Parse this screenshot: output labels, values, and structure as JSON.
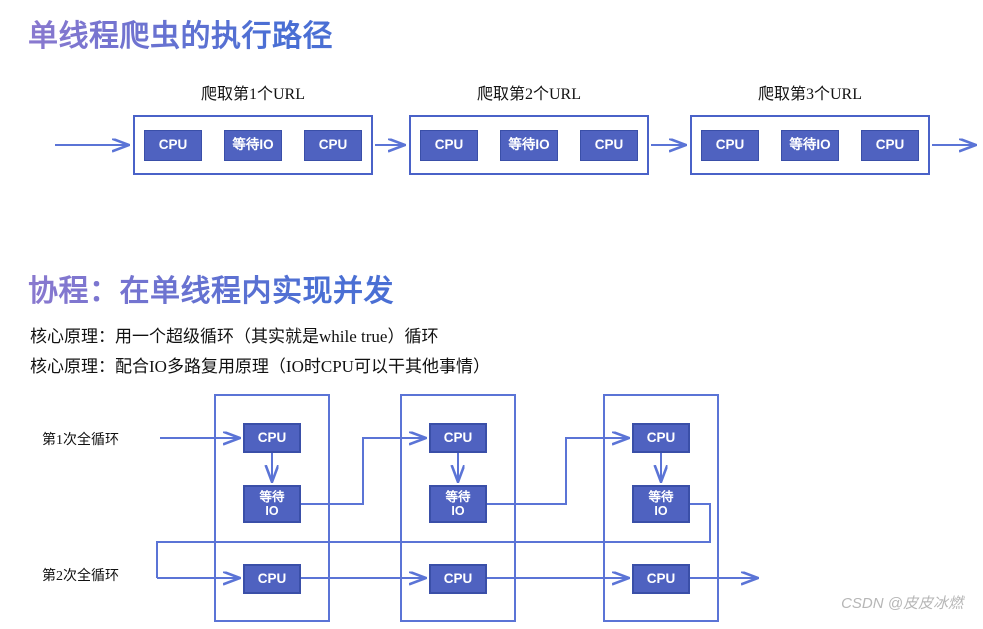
{
  "sections": {
    "top": {
      "title": "单线程爬虫的执行路径",
      "groups": [
        {
          "caption": "爬取第1个URL",
          "chips": [
            "CPU",
            "等待IO",
            "CPU"
          ]
        },
        {
          "caption": "爬取第2个URL",
          "chips": [
            "CPU",
            "等待IO",
            "CPU"
          ]
        },
        {
          "caption": "爬取第3个URL",
          "chips": [
            "CPU",
            "等待IO",
            "CPU"
          ]
        }
      ]
    },
    "bottom": {
      "title": "协程：在单线程内实现并发",
      "notes": [
        "核心原理：用一个超级循环（其实就是while true）循环",
        "核心原理：配合IO多路复用原理（IO时CPU可以干其他事情）"
      ],
      "row_labels": [
        "第1次全循环",
        "第2次全循环"
      ],
      "groups": [
        {
          "cpu_label": "CPU",
          "io_label_line1": "等待",
          "io_label_line2": "IO",
          "cpu2_label": "CPU"
        },
        {
          "cpu_label": "CPU",
          "io_label_line1": "等待",
          "io_label_line2": "IO",
          "cpu2_label": "CPU"
        },
        {
          "cpu_label": "CPU",
          "io_label_line1": "等待",
          "io_label_line2": "IO",
          "cpu2_label": "CPU"
        }
      ]
    }
  },
  "watermark": "CSDN @皮皮冰燃",
  "colors": {
    "chip_fill": "#4f62c0",
    "chip_border": "#3a4fa8",
    "group_border": "#5b74d6",
    "arrow": "#5b74d6",
    "title_gradient_from": "#8a79cf",
    "title_gradient_to": "#4a6fd4",
    "watermark": "#b6b6b6"
  }
}
